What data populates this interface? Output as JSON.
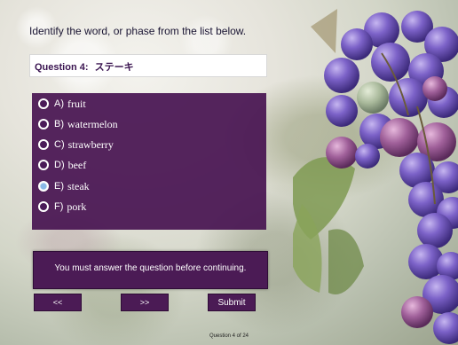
{
  "header": {
    "instruction": "Identify the word, or phase from the list below."
  },
  "question": {
    "label": "Question 4:",
    "term": "ステーキ"
  },
  "options": [
    {
      "prefix": "A)",
      "text": "fruit",
      "selected": false
    },
    {
      "prefix": "B)",
      "text": "watermelon",
      "selected": false
    },
    {
      "prefix": "C)",
      "text": "strawberry",
      "selected": false
    },
    {
      "prefix": "D)",
      "text": "beef",
      "selected": false
    },
    {
      "prefix": "E)",
      "text": "steak",
      "selected": true
    },
    {
      "prefix": "F)",
      "text": "pork",
      "selected": false
    }
  ],
  "feedback": {
    "message": "You must answer the question before continuing."
  },
  "navigation": {
    "prev_label": "<<",
    "next_label": ">>",
    "submit_label": "Submit"
  },
  "footer": {
    "progress": "Question 4 of 24"
  },
  "colors": {
    "panel": "#481452",
    "title_text": "#1a1533",
    "selected_radio": "#8ab8e8"
  },
  "icons": {
    "radio": "radio-button-icon"
  }
}
